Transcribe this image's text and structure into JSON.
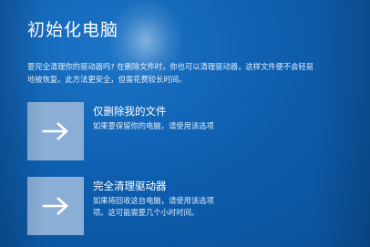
{
  "screen": {
    "title": "初始化电脑",
    "description_lines": [
      "要完全清理你的驱动器吗? 在删除文件时，你也可以清理驱动器，这样文件便不会轻易",
      "地被恢复。此方法更安全，但需花费较长时间。"
    ]
  },
  "options": [
    {
      "title": "仅删除我的文件",
      "subtitle_lines": [
        "如果要保留你的电脑，请使用该选项"
      ],
      "icon": "right-arrow-icon"
    },
    {
      "title": "完全清理驱动器",
      "subtitle_lines": [
        "如果将回收这台电脑，请使用该选项",
        "项。这可能需要几个小时时间。"
      ],
      "icon": "right-arrow-icon"
    }
  ],
  "colors": {
    "background": "#0e5fb0",
    "tile": "#8aaed6",
    "text": "#ffffff"
  }
}
